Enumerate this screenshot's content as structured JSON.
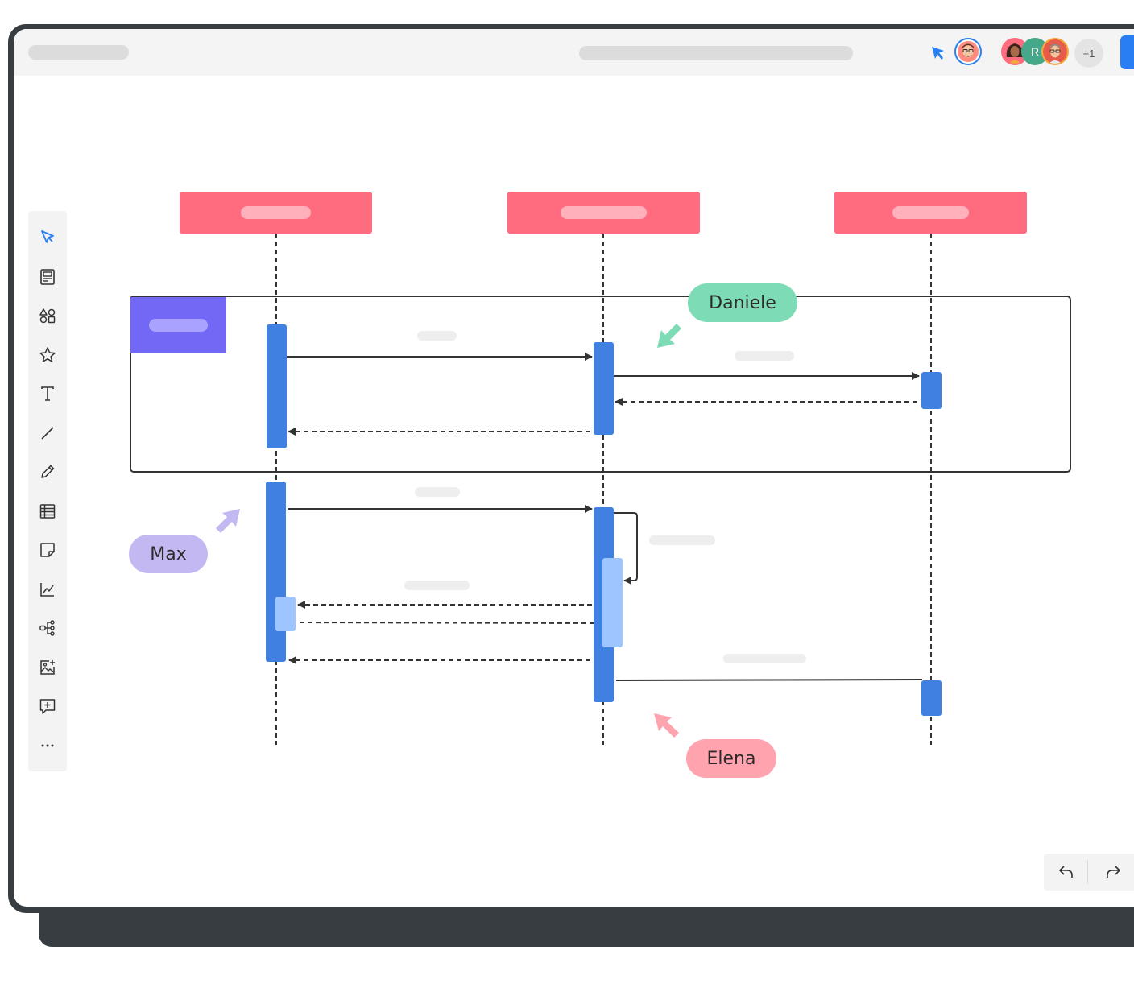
{
  "colors": {
    "participant": "#ff6b7f",
    "participant_label": "#ffb0ba",
    "activation": "#3f80e0",
    "activation_light": "#9ec5ff",
    "frame_tag": "#7368f5",
    "frame_tag_label": "#a9a3ff",
    "line": "#333333",
    "placeholder": "#eeeeee",
    "cursor_blue": "#2a7ef3",
    "cursor_green": "#7ddbb6",
    "cursor_purple": "#c4b8f2",
    "cursor_pink": "#ffa3af"
  },
  "collaborators": {
    "avatar_letter": "R",
    "more_count": "+1"
  },
  "cursors": [
    {
      "name": "Daniele",
      "color": "#7ddbb6"
    },
    {
      "name": "Max",
      "color": "#c4b8f2"
    },
    {
      "name": "Elena",
      "color": "#ffa3af"
    }
  ],
  "toolbar": {
    "tools": [
      {
        "icon": "select-arrow-icon"
      },
      {
        "icon": "template-icon"
      },
      {
        "icon": "shapes-icon"
      },
      {
        "icon": "star-icon"
      },
      {
        "icon": "text-icon"
      },
      {
        "icon": "line-icon"
      },
      {
        "icon": "pen-icon"
      },
      {
        "icon": "table-icon"
      },
      {
        "icon": "sticky-note-icon"
      },
      {
        "icon": "chart-icon"
      },
      {
        "icon": "mind-map-icon"
      },
      {
        "icon": "image-upload-icon"
      },
      {
        "icon": "comment-add-icon"
      },
      {
        "icon": "more-icon"
      }
    ]
  },
  "history": {
    "undo_icon": "undo-icon",
    "redo_icon": "redo-icon"
  }
}
